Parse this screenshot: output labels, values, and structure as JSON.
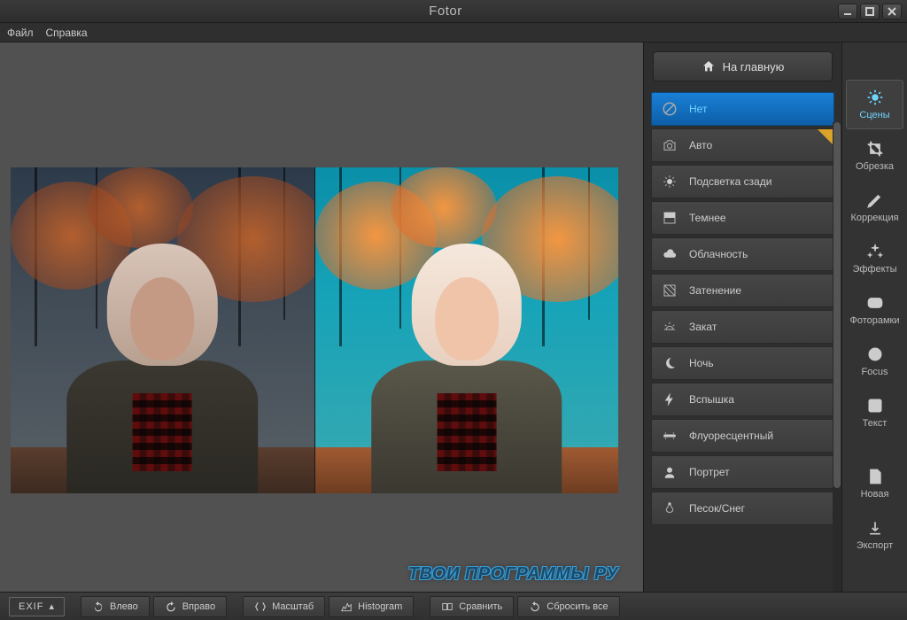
{
  "app": {
    "title": "Fotor"
  },
  "menu": {
    "file": "Файл",
    "help": "Справка"
  },
  "home_button": "На главную",
  "scenes": {
    "items": [
      {
        "label": "Нет",
        "icon": "none",
        "active": true
      },
      {
        "label": "Авто",
        "icon": "camera",
        "starred": true
      },
      {
        "label": "Подсветка сзади",
        "icon": "backlight"
      },
      {
        "label": "Темнее",
        "icon": "darken"
      },
      {
        "label": "Облачность",
        "icon": "cloudy"
      },
      {
        "label": "Затенение",
        "icon": "shade"
      },
      {
        "label": "Закат",
        "icon": "sunset"
      },
      {
        "label": "Ночь",
        "icon": "night"
      },
      {
        "label": "Вспышка",
        "icon": "flash"
      },
      {
        "label": "Флуоресцентный",
        "icon": "fluorescent"
      },
      {
        "label": "Портрет",
        "icon": "portrait"
      },
      {
        "label": "Песок/Снег",
        "icon": "sandsnow"
      }
    ]
  },
  "tools": {
    "scenes": "Сцены",
    "crop": "Обрезка",
    "adjust": "Коррекция",
    "effects": "Эффекты",
    "frames": "Фоторамки",
    "focus": "Focus",
    "text": "Текст",
    "new": "Новая",
    "export": "Экспорт"
  },
  "bottom": {
    "exif": "EXIF",
    "rotate_left": "Влево",
    "rotate_right": "Вправо",
    "zoom": "Масштаб",
    "histogram": "Histogram",
    "compare": "Сравнить",
    "reset": "Сбросить все"
  },
  "watermark": "ТВОИ ПРОГРАММЫ РУ"
}
